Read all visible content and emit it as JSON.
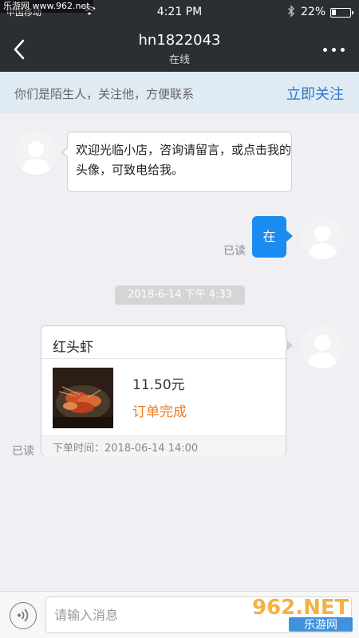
{
  "status_bar": {
    "carrier": "中国移动",
    "time": "4:21 PM",
    "battery": "22%",
    "battery_level": 0.22
  },
  "header": {
    "title": "hn1822043",
    "subtitle": "在线"
  },
  "banner": {
    "text": "你们是陌生人，关注他，方便联系",
    "follow_label": "立即关注"
  },
  "messages": {
    "incoming_text": "欢迎光临小店，咨询请留言，或点击我的头像，可致电给我。",
    "outgoing_text": "在",
    "outgoing_read": "已读",
    "timestamp": "2018-6-14 下午 4:33",
    "order": {
      "name": "红头虾",
      "price": "11.50元",
      "status": "订单完成",
      "order_time": "下单时间：2018-06-14 14:00",
      "read": "已读"
    }
  },
  "input": {
    "placeholder": "请输入消息"
  },
  "watermark": {
    "top_text": "乐游网 www.962.net",
    "logo_text": "962.NET",
    "logo_sub": "乐游网"
  },
  "colors": {
    "header_bg": "#2b2e33",
    "accent_blue": "#1a8cf0",
    "link_blue": "#2a7ad2",
    "order_status": "#f07a1e"
  }
}
